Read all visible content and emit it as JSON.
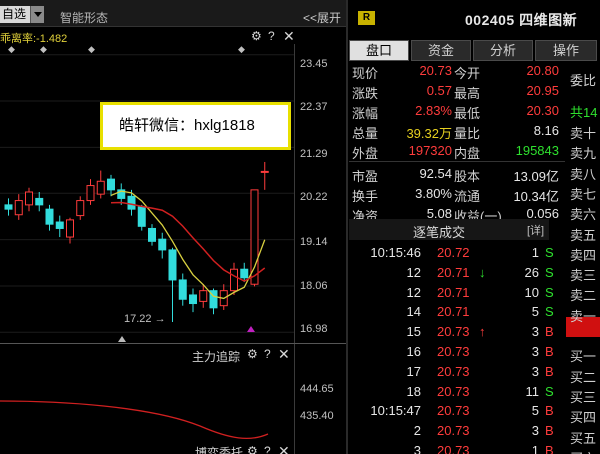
{
  "chart_toolbar": {
    "watchlist_label": "自选",
    "smart_shape_label": "智能形态",
    "expand_label": "<<展开",
    "deviation_label": "乖离率:-1.482"
  },
  "price_axis": [
    "23.45",
    "22.37",
    "21.29",
    "20.22",
    "19.14",
    "18.06",
    "16.98"
  ],
  "low_annotation": "17.22",
  "watermark_text": "皓轩微信：hxlg1818",
  "sub_chart": {
    "title": "主力追踪",
    "axis": [
      "444.65",
      "435.40"
    ],
    "second_title": "博弈委托"
  },
  "chart_data": {
    "type": "candlestick",
    "candles": [
      {
        "o": 19.95,
        "c": 19.85,
        "h": 20.1,
        "l": 19.7
      },
      {
        "o": 19.72,
        "c": 20.05,
        "h": 20.2,
        "l": 19.6
      },
      {
        "o": 19.95,
        "c": 20.25,
        "h": 20.35,
        "l": 19.8
      },
      {
        "o": 20.1,
        "c": 19.95,
        "h": 20.25,
        "l": 19.8
      },
      {
        "o": 19.85,
        "c": 19.5,
        "h": 19.95,
        "l": 19.35
      },
      {
        "o": 19.55,
        "c": 19.4,
        "h": 19.7,
        "l": 19.2
      },
      {
        "o": 19.2,
        "c": 19.6,
        "h": 19.65,
        "l": 19.05
      },
      {
        "o": 19.7,
        "c": 20.05,
        "h": 20.15,
        "l": 19.6
      },
      {
        "o": 20.05,
        "c": 20.4,
        "h": 20.55,
        "l": 19.95
      },
      {
        "o": 20.2,
        "c": 20.5,
        "h": 20.75,
        "l": 20.1
      },
      {
        "o": 20.55,
        "c": 20.3,
        "h": 20.65,
        "l": 20.15
      },
      {
        "o": 20.3,
        "c": 20.1,
        "h": 20.45,
        "l": 19.95
      },
      {
        "o": 20.15,
        "c": 19.85,
        "h": 20.3,
        "l": 19.7
      },
      {
        "o": 19.9,
        "c": 19.45,
        "h": 19.95,
        "l": 19.35
      },
      {
        "o": 19.4,
        "c": 19.1,
        "h": 19.5,
        "l": 19.0
      },
      {
        "o": 19.15,
        "c": 18.9,
        "h": 19.3,
        "l": 18.7
      },
      {
        "o": 18.9,
        "c": 18.2,
        "h": 18.95,
        "l": 17.22
      },
      {
        "o": 18.2,
        "c": 17.75,
        "h": 18.35,
        "l": 17.6
      },
      {
        "o": 17.85,
        "c": 17.65,
        "h": 18.0,
        "l": 17.45
      },
      {
        "o": 17.7,
        "c": 17.95,
        "h": 18.1,
        "l": 17.55
      },
      {
        "o": 17.95,
        "c": 17.55,
        "h": 18.0,
        "l": 17.4
      },
      {
        "o": 17.6,
        "c": 17.95,
        "h": 18.1,
        "l": 17.5
      },
      {
        "o": 17.95,
        "c": 18.45,
        "h": 18.6,
        "l": 17.85
      },
      {
        "o": 18.45,
        "c": 18.25,
        "h": 18.6,
        "l": 18.15
      },
      {
        "o": 18.1,
        "c": 20.3,
        "h": 20.3,
        "l": 18.05
      },
      {
        "o": 20.73,
        "c": 20.73,
        "h": 20.95,
        "l": 20.3
      }
    ],
    "ylim": [
      16.8,
      23.7
    ],
    "low_label": "17.22"
  },
  "quote": {
    "badge": "R",
    "code_name": "002405 四维图新",
    "tabs": [
      "盘口",
      "资金",
      "分析",
      "操作"
    ],
    "rows": [
      {
        "l1": "现价",
        "v1": "20.73",
        "c1": "red",
        "l2": "今开",
        "v2": "20.80",
        "c2": "red"
      },
      {
        "l1": "涨跌",
        "v1": "0.57",
        "c1": "red",
        "l2": "最高",
        "v2": "20.95",
        "c2": "red"
      },
      {
        "l1": "涨幅",
        "v1": "2.83%",
        "c1": "red",
        "l2": "最低",
        "v2": "20.30",
        "c2": "red"
      },
      {
        "l1": "总量",
        "v1": "39.32万",
        "c1": "yellow",
        "l2": "量比",
        "v2": "8.16",
        "c2": "white"
      },
      {
        "l1": "外盘",
        "v1": "197320",
        "c1": "red",
        "l2": "内盘",
        "v2": "195843",
        "c2": "green"
      },
      {
        "l1": "市盈",
        "v1": "92.54",
        "c1": "white",
        "l2": "股本",
        "v2": "13.09亿",
        "c2": "white"
      },
      {
        "l1": "换手",
        "v1": "3.80%",
        "c1": "white",
        "l2": "流通",
        "v2": "10.34亿",
        "c2": "white"
      },
      {
        "l1": "净资",
        "v1": "5.08",
        "c1": "white",
        "l2": "收益(一)",
        "v2": "0.056",
        "c2": "white"
      }
    ],
    "commit_label": "委比",
    "total_label": "共14",
    "trans_title": "逐笔成交",
    "detail_label": "[详]",
    "trades": [
      {
        "time": "10:15:46",
        "price": "20.72",
        "arrow": "",
        "vol": "1",
        "side": "S",
        "side_color": "green"
      },
      {
        "time": "12",
        "price": "20.71",
        "arrow": "↓",
        "vol": "26",
        "side": "S",
        "side_color": "green"
      },
      {
        "time": "12",
        "price": "20.71",
        "arrow": "",
        "vol": "10",
        "side": "S",
        "side_color": "green"
      },
      {
        "time": "14",
        "price": "20.71",
        "arrow": "",
        "vol": "5",
        "side": "S",
        "side_color": "green"
      },
      {
        "time": "15",
        "price": "20.73",
        "arrow": "↑",
        "vol": "3",
        "side": "B",
        "side_color": "red"
      },
      {
        "time": "16",
        "price": "20.73",
        "arrow": "",
        "vol": "3",
        "side": "B",
        "side_color": "red"
      },
      {
        "time": "17",
        "price": "20.73",
        "arrow": "",
        "vol": "3",
        "side": "B",
        "side_color": "red"
      },
      {
        "time": "18",
        "price": "20.73",
        "arrow": "",
        "vol": "11",
        "side": "S",
        "side_color": "green"
      },
      {
        "time": "10:15:47",
        "price": "20.73",
        "arrow": "",
        "vol": "5",
        "side": "B",
        "side_color": "red"
      },
      {
        "time": "2",
        "price": "20.73",
        "arrow": "",
        "vol": "3",
        "side": "B",
        "side_color": "red"
      },
      {
        "time": "3",
        "price": "20.73",
        "arrow": "",
        "vol": "1",
        "side": "B",
        "side_color": "red"
      }
    ],
    "orderbook": [
      "卖十",
      "卖九",
      "卖八",
      "卖七",
      "卖六",
      "卖五",
      "卖四",
      "卖三",
      "卖二",
      "卖一",
      "",
      "买一",
      "买二",
      "买三",
      "买四",
      "买五",
      "买六"
    ]
  }
}
